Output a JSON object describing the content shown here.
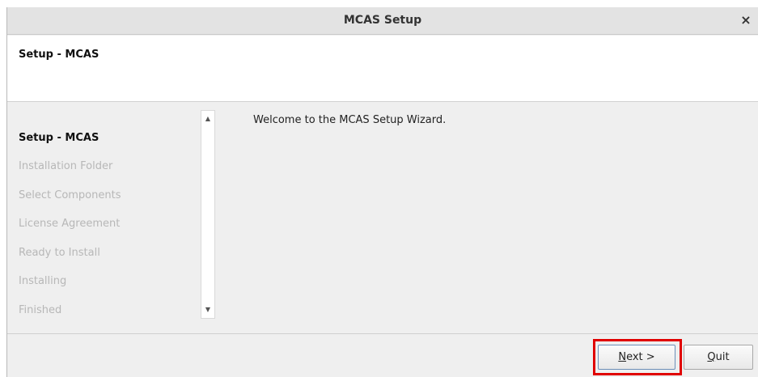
{
  "window": {
    "title": "MCAS Setup",
    "close_glyph": "×"
  },
  "header": {
    "heading": "Setup - MCAS"
  },
  "sidebar": {
    "steps": [
      {
        "label": "Setup - MCAS",
        "active": true
      },
      {
        "label": "Installation Folder",
        "active": false
      },
      {
        "label": "Select Components",
        "active": false
      },
      {
        "label": "License Agreement",
        "active": false
      },
      {
        "label": "Ready to Install",
        "active": false
      },
      {
        "label": "Installing",
        "active": false
      },
      {
        "label": "Finished",
        "active": false
      }
    ],
    "scroll_up_icon": "▲",
    "scroll_down_icon": "▼"
  },
  "content": {
    "welcome": "Welcome to the MCAS Setup Wizard."
  },
  "footer": {
    "next_mnemonic": "N",
    "next_rest": "ext >",
    "quit_mnemonic": "Q",
    "quit_rest": "uit"
  }
}
